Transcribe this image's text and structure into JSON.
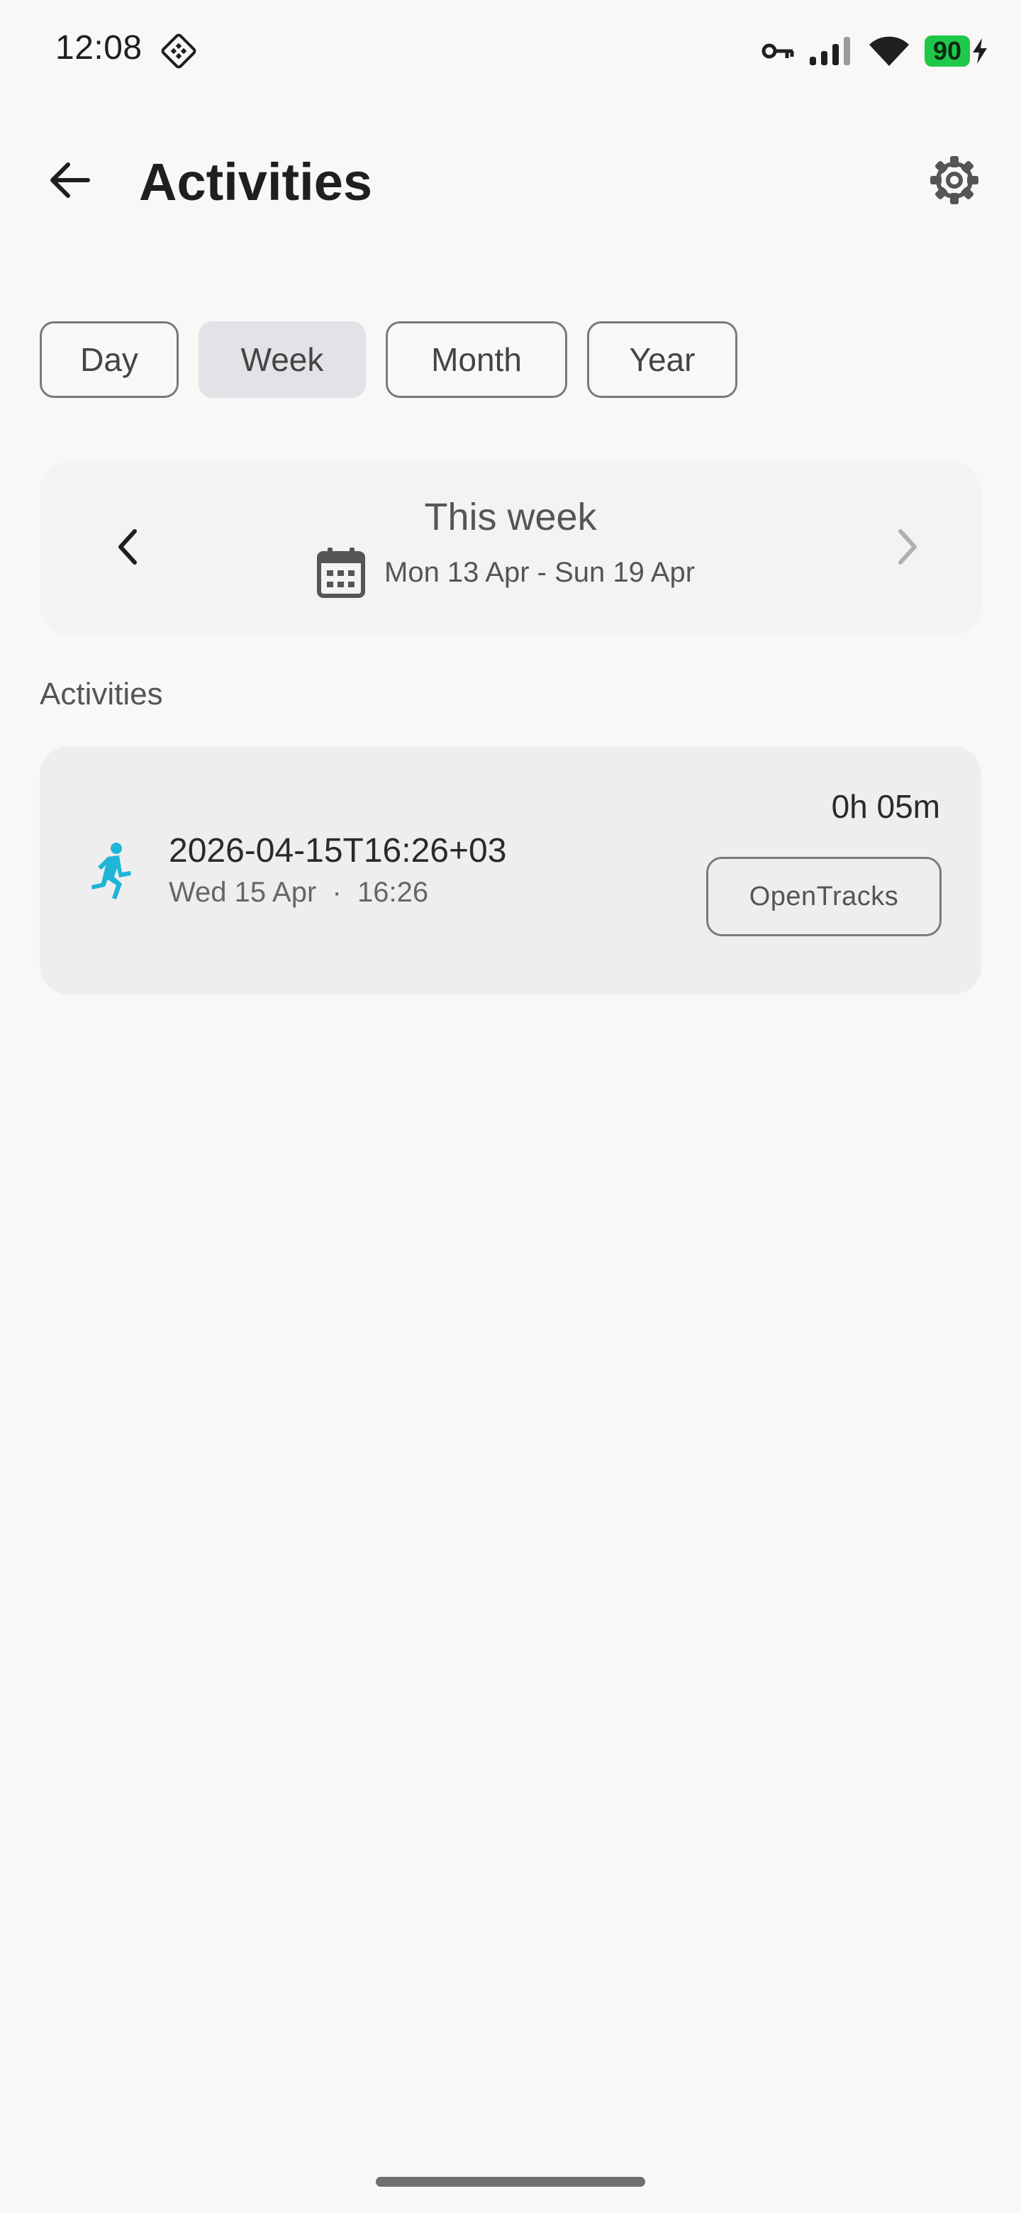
{
  "status_bar": {
    "time": "12:08",
    "battery_level": "90",
    "icons": [
      "vpn-key-icon",
      "signal-icon",
      "wifi-icon",
      "battery-icon",
      "charging-icon"
    ]
  },
  "app_bar": {
    "title": "Activities",
    "back_icon": "arrow-back-icon",
    "settings_icon": "gear-icon"
  },
  "period_chips": [
    {
      "label": "Day",
      "selected": false
    },
    {
      "label": "Week",
      "selected": true
    },
    {
      "label": "Month",
      "selected": false
    },
    {
      "label": "Year",
      "selected": false
    }
  ],
  "week_navigator": {
    "title": "This week",
    "range": "Mon 13 Apr - Sun 19 Apr"
  },
  "activities_section": {
    "heading": "Activities",
    "items": [
      {
        "title": "2026-04-15T16:26+03",
        "subtitle": "Wed 15 Apr  ·  16:26",
        "duration": "0h 05m",
        "source": "OpenTracks",
        "icon": "running-icon",
        "icon_color": "#1fb5d6"
      }
    ]
  }
}
